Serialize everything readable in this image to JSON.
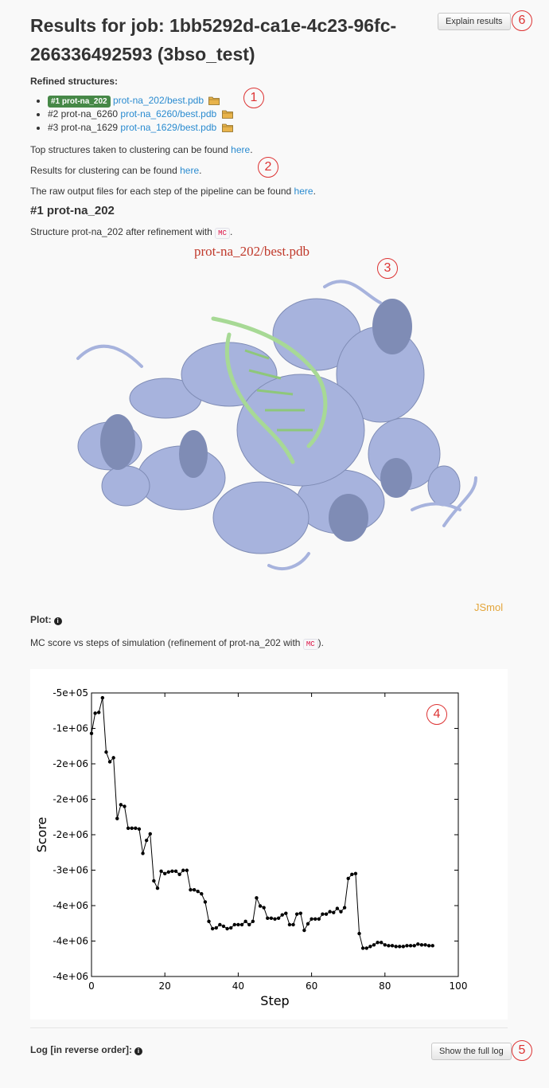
{
  "header": {
    "title": "Results for job: 1bb5292d-ca1e-4c23-96fc-266336492593 (3bso_test)",
    "explain_button": "Explain results"
  },
  "refined": {
    "heading": "Refined structures:",
    "items": [
      {
        "badge": "#1 prot-na_202",
        "name": "",
        "link": "prot-na_202/best.pdb"
      },
      {
        "badge": "",
        "name": "#2 prot-na_6260",
        "link": "prot-na_6260/best.pdb"
      },
      {
        "badge": "",
        "name": "#3 prot-na_1629",
        "link": "prot-na_1629/best.pdb"
      }
    ]
  },
  "info": {
    "top_structures": {
      "text": "Top structures taken to clustering can be found ",
      "link": "here",
      "end": "."
    },
    "clustering": {
      "text": "Results for clustering can be found ",
      "link": "here",
      "end": "."
    },
    "raw_output": {
      "text": "The raw output files for each step of the pipeline can be found ",
      "link": "here",
      "end": "."
    }
  },
  "section": {
    "heading": "#1 prot-na_202",
    "desc_prefix": "Structure prot-na_202 after refinement with ",
    "desc_code": "MC",
    "desc_suffix": "."
  },
  "viewer": {
    "title": "prot-na_202/best.pdb",
    "brand": "JSmol",
    "protein_color": "#a7b3dd",
    "dna_color": "#a7d995"
  },
  "plot": {
    "label": "Plot:",
    "desc_prefix": "MC score vs steps of simulation (refinement of prot-na_202 with ",
    "desc_code": "MC",
    "desc_suffix": ")."
  },
  "log": {
    "label": "Log [in reverse order]:",
    "button": "Show the full log"
  },
  "callouts": [
    "1",
    "2",
    "3",
    "4",
    "5",
    "6"
  ],
  "chart_data": {
    "type": "line",
    "xlabel": "Step",
    "ylabel": "Score",
    "xlim": [
      0,
      100
    ],
    "xticks": [
      "0",
      "20",
      "40",
      "60",
      "80",
      "100"
    ],
    "yticks": [
      "-5e+05",
      "-1e+06",
      "-2e+06",
      "-2e+06",
      "-2e+06",
      "-3e+06",
      "-4e+06",
      "-4e+06",
      "-4e+06"
    ],
    "ylim": [
      -4000000,
      -500000
    ],
    "x": [
      0,
      1,
      2,
      3,
      4,
      5,
      6,
      7,
      8,
      9,
      10,
      11,
      12,
      13,
      14,
      15,
      16,
      17,
      18,
      19,
      20,
      21,
      22,
      23,
      24,
      25,
      26,
      27,
      28,
      29,
      30,
      31,
      32,
      33,
      34,
      35,
      36,
      37,
      38,
      39,
      40,
      41,
      42,
      43,
      44,
      45,
      46,
      47,
      48,
      49,
      50,
      51,
      52,
      53,
      54,
      55,
      56,
      57,
      58,
      59,
      60,
      61,
      62,
      63,
      64,
      65,
      66,
      67,
      68,
      69,
      70,
      71,
      72,
      73,
      74,
      75,
      76,
      77,
      78,
      79,
      80,
      81,
      82,
      83,
      84,
      85,
      86,
      87,
      88,
      89,
      90,
      91,
      92,
      93
    ],
    "y": [
      -1000000,
      -750000,
      -740000,
      -560000,
      -1230000,
      -1350000,
      -1300000,
      -2050000,
      -1880000,
      -1900000,
      -2170000,
      -2170000,
      -2170000,
      -2180000,
      -2480000,
      -2320000,
      -2240000,
      -2820000,
      -2910000,
      -2700000,
      -2730000,
      -2710000,
      -2700000,
      -2700000,
      -2740000,
      -2690000,
      -2690000,
      -2930000,
      -2930000,
      -2950000,
      -2980000,
      -3080000,
      -3320000,
      -3410000,
      -3400000,
      -3360000,
      -3380000,
      -3410000,
      -3400000,
      -3360000,
      -3360000,
      -3360000,
      -3320000,
      -3360000,
      -3320000,
      -3030000,
      -3130000,
      -3150000,
      -3280000,
      -3280000,
      -3290000,
      -3280000,
      -3240000,
      -3220000,
      -3360000,
      -3360000,
      -3230000,
      -3220000,
      -3430000,
      -3350000,
      -3290000,
      -3290000,
      -3290000,
      -3230000,
      -3230000,
      -3200000,
      -3210000,
      -3160000,
      -3200000,
      -3150000,
      -2790000,
      -2740000,
      -2730000,
      -3470000,
      -3650000,
      -3650000,
      -3630000,
      -3610000,
      -3580000,
      -3580000,
      -3610000,
      -3620000,
      -3620000,
      -3630000,
      -3630000,
      -3630000,
      -3620000,
      -3620000,
      -3620000,
      -3600000,
      -3610000,
      -3610000,
      -3620000,
      -3620000
    ]
  }
}
